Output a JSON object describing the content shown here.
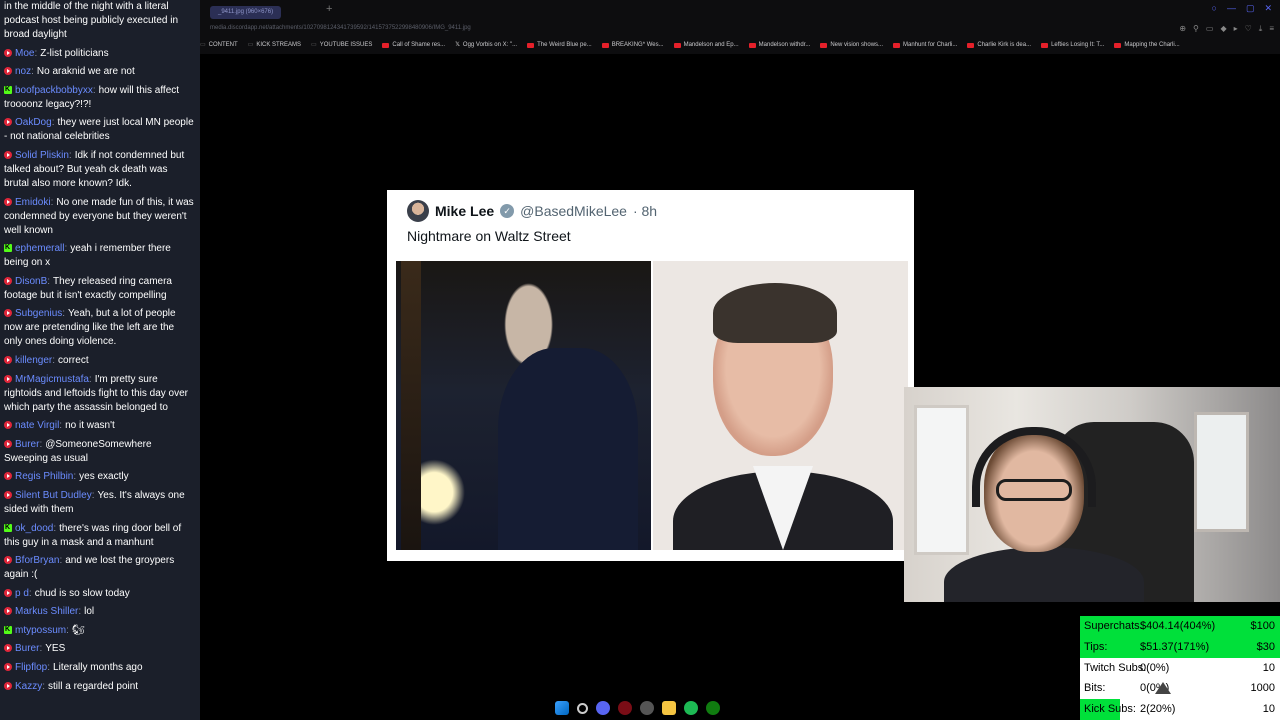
{
  "chat": {
    "top_text": "in the middle of the night with a literal podcast host being publicly executed in broad daylight",
    "messages": [
      {
        "platform": "youtube",
        "user": "Moe",
        "text": "Z-list politicians"
      },
      {
        "platform": "youtube",
        "user": "noz",
        "text": "No araknid we are not"
      },
      {
        "platform": "kick",
        "user": "boofpackbobbyxx",
        "text": "how will this affect troooonz legacy?!?!"
      },
      {
        "platform": "youtube",
        "user": "OakDog",
        "text": "they were just local MN people - not national celebrities"
      },
      {
        "platform": "youtube",
        "user": "Solid Pliskin",
        "text": "Idk if not condemned but talked about? But yeah ck death was brutal also more known? Idk."
      },
      {
        "platform": "youtube",
        "user": "Emidoki",
        "text": "No one made fun of this, it was condemned by everyone but they weren't well known"
      },
      {
        "platform": "kick",
        "user": "ephemerall",
        "text": "yeah i remember there being on x"
      },
      {
        "platform": "youtube",
        "user": "DisonB",
        "text": "They released ring camera footage but it isn't exactly compelling"
      },
      {
        "platform": "youtube",
        "user": "Subgenius",
        "text": "Yeah, but a lot of people now are pretending like the left are the only ones doing violence."
      },
      {
        "platform": "youtube",
        "user": "killenger",
        "text": "correct"
      },
      {
        "platform": "youtube",
        "user": "MrMagicmustafa",
        "text": "I'm pretty sure rightoids and leftoids fight to this day over which party the assassin belonged to"
      },
      {
        "platform": "youtube",
        "user": "nate Virgil",
        "text": "no it wasn't"
      },
      {
        "platform": "youtube",
        "user": "Burer",
        "text": "@SomeoneSomewhere Sweeping as usual"
      },
      {
        "platform": "youtube",
        "user": "Regis Philbin",
        "text": "yes exactly"
      },
      {
        "platform": "youtube",
        "user": "Silent But Dudley",
        "text": "Yes. It's always one sided with them"
      },
      {
        "platform": "kick",
        "user": "ok_dood",
        "text": "there's was ring door bell of this guy in a mask and a manhunt"
      },
      {
        "platform": "youtube",
        "user": "BforBryan",
        "text": "and we lost the groypers again :("
      },
      {
        "platform": "youtube",
        "user": "p d",
        "text": "chud is so slow today"
      },
      {
        "platform": "youtube",
        "user": "Markus Shiller",
        "text": "lol"
      },
      {
        "platform": "kick",
        "user": "mtypossum",
        "text": "🐿"
      },
      {
        "platform": "youtube",
        "user": "Burer",
        "text": "YES"
      },
      {
        "platform": "youtube",
        "user": "Flipflop",
        "text": "Literally months ago"
      },
      {
        "platform": "youtube",
        "user": "Kazzy",
        "text": "still a regarded point"
      }
    ]
  },
  "browser": {
    "tab_title": "_9411.jpg (960×676)",
    "url": "media.discordapp.net/attachments/1027098124341739592/1415737522998480906/IMG_9411.jpg",
    "bookmarks": [
      {
        "icon": "none",
        "label": "CONTENT"
      },
      {
        "icon": "none",
        "label": "KICK STREAMS"
      },
      {
        "icon": "none",
        "label": "YOUTUBE ISSUES"
      },
      {
        "icon": "youtube",
        "label": "Call of Shame res..."
      },
      {
        "icon": "x",
        "label": "Ogg Vorbis on X: \"..."
      },
      {
        "icon": "youtube",
        "label": "The Weird Blue pe..."
      },
      {
        "icon": "youtube",
        "label": "BREAKING* Wes..."
      },
      {
        "icon": "youtube",
        "label": "Mandelson and Ep..."
      },
      {
        "icon": "youtube",
        "label": "Mandelson withdr..."
      },
      {
        "icon": "youtube",
        "label": "New vision shows..."
      },
      {
        "icon": "youtube",
        "label": "Manhunt for Charli..."
      },
      {
        "icon": "youtube",
        "label": "Charlie Kirk is dea..."
      },
      {
        "icon": "youtube",
        "label": "Lefties Losing It: T..."
      },
      {
        "icon": "youtube",
        "label": "Mapping the Charli..."
      }
    ]
  },
  "tweet": {
    "name": "Mike Lee",
    "handle": "@BasedMikeLee",
    "time": "· 8h",
    "text": "Nightmare on Waltz Street"
  },
  "stats": {
    "rows": [
      {
        "label": "Superchats:",
        "value": "$404.14(404%)",
        "goal": "$100",
        "progress": 1.0
      },
      {
        "label": "Tips:",
        "value": "$51.37(171%)",
        "goal": "$30",
        "progress": 1.0
      },
      {
        "label": "Twitch Subs:",
        "value": "0(0%)",
        "goal": "10",
        "progress": 0.0
      },
      {
        "label": "Bits:",
        "value": "0(0%)",
        "goal": "1000",
        "progress": 0.0
      },
      {
        "label": "Kick Subs:",
        "value": "2(20%)",
        "goal": "10",
        "progress": 0.2
      }
    ]
  },
  "colors": {
    "chat_bg": "#1b1f2a",
    "username": "#6b8cff",
    "youtube_red": "#e0263a",
    "kick_green": "#53fc18",
    "stat_green": "#00e03a"
  }
}
